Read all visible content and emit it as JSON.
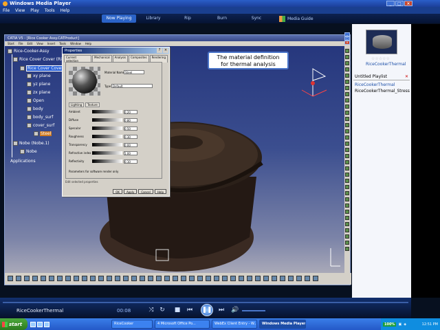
{
  "wmp": {
    "title": "Windows Media Player",
    "menu": [
      "File",
      "View",
      "Play",
      "Tools",
      "Help"
    ],
    "tabs": [
      "Now Playing",
      "Library",
      "Rip",
      "Burn",
      "Sync",
      "Media Guide"
    ]
  },
  "catia": {
    "title": "CATIA V5 - [Rice Cooker Assy.CATProduct]",
    "menu": [
      "Start",
      "File",
      "Edit",
      "View",
      "Insert",
      "Tools",
      "Window",
      "Help"
    ]
  },
  "tree": {
    "root": "Rice-Cooker-Assy",
    "cover": "Rice Cover Cover (Rice",
    "selected": "Rice Cover Cover",
    "xy": "xy plane",
    "yz": "yz plane",
    "zx": "zx plane",
    "open": "Open",
    "body": "body",
    "body_surf": "body_surf",
    "cover_surf": "cover_surf",
    "steel": "Steel",
    "nobe_inst": "Nobe (Nobe.1)",
    "nobe": "Nobe",
    "applications": "Applications"
  },
  "callout": {
    "line1": "The material definition",
    "line2": "for thermal analysis"
  },
  "dialog": {
    "title": "Properties",
    "tabs": [
      "Current selection",
      "Mechanical",
      "Analysis",
      "Composites",
      "Rendering",
      "Feature Properties"
    ],
    "material_label": "Material Name",
    "material_value": "Steel",
    "type_label": "Type",
    "type_value": "Default",
    "subtabs": [
      "Lighting",
      "Texture"
    ],
    "rows": [
      {
        "label": "Ambient",
        "value": "0.20"
      },
      {
        "label": "Diffuse",
        "value": "0.80"
      },
      {
        "label": "Specular",
        "value": "0.50"
      },
      {
        "label": "Roughness",
        "value": "0.30"
      },
      {
        "label": "Transparency",
        "value": "0.00"
      },
      {
        "label": "Refractive index",
        "value": "1.00"
      },
      {
        "label": "Reflectivity",
        "value": "0.10"
      }
    ],
    "checkbox": "Parameters for software render only",
    "status": "Edit selected properties",
    "ok": "OK",
    "apply": "Apply",
    "cancel": "Cancel",
    "help": "Help"
  },
  "right_pane": {
    "stars": "☆☆☆☆☆",
    "now_title": "RiceCookerThermal",
    "playlist_label": "Untitled Playlist",
    "items": [
      "RiceCookerThermal",
      "RiceCookerThermal_Stress"
    ]
  },
  "player": {
    "now_playing": "RiceCookerThermal",
    "time": "00:08"
  },
  "taskbar": {
    "start": "start",
    "buttons": [
      "RiceCooker",
      "4 Microsoft Office Po...",
      "WebEx Client Entry - W...",
      "Windows Media Player"
    ],
    "battery": "100%",
    "clock": "12:51 PM"
  }
}
